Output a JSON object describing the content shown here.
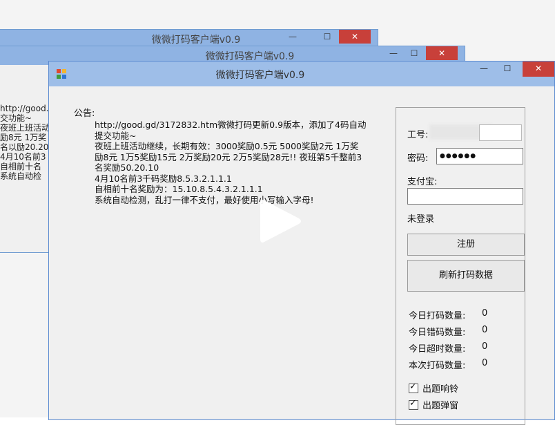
{
  "back_window_1": {
    "title": "微微打码客户端v0.9",
    "controls": {
      "minimize": "—",
      "maximize": "☐",
      "close": "✕"
    }
  },
  "back_window_2": {
    "title": "微微打码客户端v0.9",
    "controls": {
      "minimize": "—",
      "maximize": "☐",
      "close": "✕"
    }
  },
  "back_notice_lines": [
    "http://good.c",
    "交功能~",
    "夜班上班活动",
    "励8元 1万奖",
    "名以励20.20",
    "4月10名前3",
    "自相前十名",
    "系统自动检"
  ],
  "window": {
    "title": "微微打码客户端v0.9",
    "controls": {
      "minimize": "—",
      "maximize": "☐",
      "close": "✕"
    }
  },
  "notice": {
    "label": "公告:",
    "lines": [
      "http://good.gd/3172832.htm微微打码更新0.9版本，添加了4码自动",
      "提交功能~",
      "夜班上班活动继续，长期有效：3000奖励0.5元 5000奖励2元 1万奖",
      "励8元 1万5奖励15元 2万奖励20元 2万5奖励28元!! 夜班第5千整前3",
      "名奖励50.20.10",
      "4月10名前3千码奖励8.5.3.2.1.1.1",
      "自相前十名奖励为：15.10.8.5.4.3.2.1.1.1",
      "系统自动检测，乱打一律不支付，最好使用小写输入字母!"
    ]
  },
  "login": {
    "id_label": "工号:",
    "password_label": "密码:",
    "password_value": "●●●●●●",
    "alipay_label": "支付宝:",
    "alipay_value": "",
    "status": "未登录",
    "register_button": "注册",
    "refresh_button": "刷新打码数据"
  },
  "stats": [
    {
      "label": "今日打码数量:",
      "value": "0"
    },
    {
      "label": "今日错码数量:",
      "value": "0"
    },
    {
      "label": "今日超时数量:",
      "value": "0"
    },
    {
      "label": "本次打码数量:",
      "value": "0"
    }
  ],
  "checkboxes": [
    {
      "label": "出题响铃",
      "checked": "✓"
    },
    {
      "label": "出题弹窗",
      "checked": "✓"
    }
  ],
  "colors": {
    "titlebar": "#9ebee8",
    "close": "#c8403a",
    "window_bg": "#f0f0f0"
  },
  "overlay": {
    "icon": "play-icon"
  }
}
